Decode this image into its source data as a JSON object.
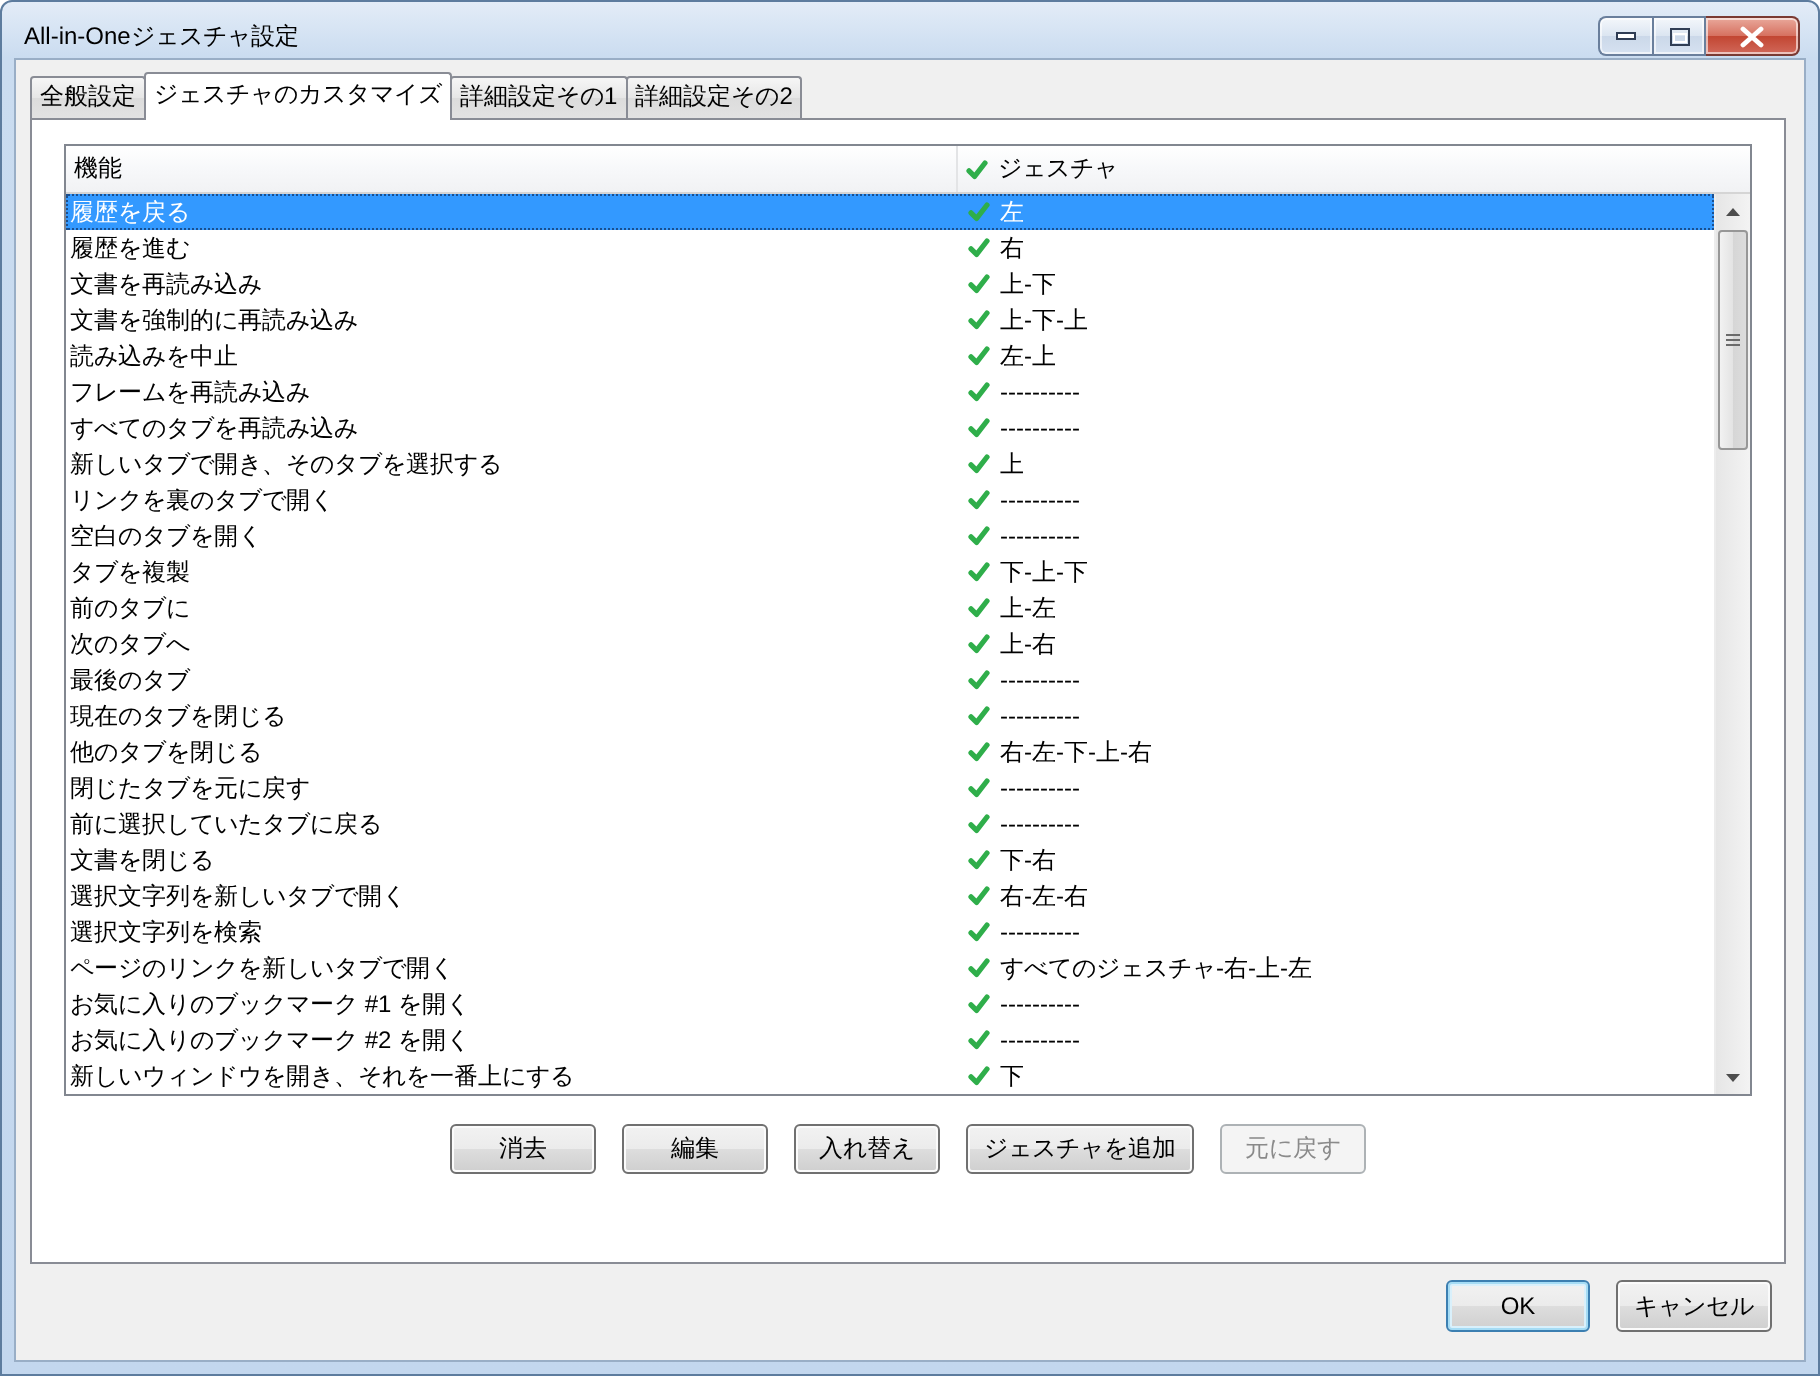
{
  "window": {
    "title": "All-in-Oneジェスチャ設定"
  },
  "tabs": [
    {
      "label": "全般設定",
      "selected": false
    },
    {
      "label": "ジェスチャのカスタマイズ",
      "selected": true
    },
    {
      "label": "詳細設定その1",
      "selected": false
    },
    {
      "label": "詳細設定その2",
      "selected": false
    }
  ],
  "gesture_list": {
    "columns": [
      {
        "label": "機能"
      },
      {
        "label": "ジェスチャ"
      }
    ],
    "rows": [
      {
        "function": "履歴を戻る",
        "enabled": true,
        "gesture": "左",
        "selected": true
      },
      {
        "function": "履歴を進む",
        "enabled": true,
        "gesture": "右",
        "selected": false
      },
      {
        "function": "文書を再読み込み",
        "enabled": true,
        "gesture": "上-下",
        "selected": false
      },
      {
        "function": "文書を強制的に再読み込み",
        "enabled": true,
        "gesture": "上-下-上",
        "selected": false
      },
      {
        "function": "読み込みを中止",
        "enabled": true,
        "gesture": "左-上",
        "selected": false
      },
      {
        "function": "フレームを再読み込み",
        "enabled": true,
        "gesture": "----------",
        "selected": false
      },
      {
        "function": "すべてのタブを再読み込み",
        "enabled": true,
        "gesture": "----------",
        "selected": false
      },
      {
        "function": "新しいタブで開き、そのタブを選択する",
        "enabled": true,
        "gesture": "上",
        "selected": false
      },
      {
        "function": "リンクを裏のタブで開く",
        "enabled": true,
        "gesture": "----------",
        "selected": false
      },
      {
        "function": "空白のタブを開く",
        "enabled": true,
        "gesture": "----------",
        "selected": false
      },
      {
        "function": "タブを複製",
        "enabled": true,
        "gesture": "下-上-下",
        "selected": false
      },
      {
        "function": "前のタブに",
        "enabled": true,
        "gesture": "上-左",
        "selected": false
      },
      {
        "function": "次のタブへ",
        "enabled": true,
        "gesture": "上-右",
        "selected": false
      },
      {
        "function": "最後のタブ",
        "enabled": true,
        "gesture": "----------",
        "selected": false
      },
      {
        "function": "現在のタブを閉じる",
        "enabled": true,
        "gesture": "----------",
        "selected": false
      },
      {
        "function": "他のタブを閉じる",
        "enabled": true,
        "gesture": "右-左-下-上-右",
        "selected": false
      },
      {
        "function": "閉じたタブを元に戻す",
        "enabled": true,
        "gesture": "----------",
        "selected": false
      },
      {
        "function": "前に選択していたタブに戻る",
        "enabled": true,
        "gesture": "----------",
        "selected": false
      },
      {
        "function": "文書を閉じる",
        "enabled": true,
        "gesture": "下-右",
        "selected": false
      },
      {
        "function": "選択文字列を新しいタブで開く",
        "enabled": true,
        "gesture": "右-左-右",
        "selected": false
      },
      {
        "function": "選択文字列を検索",
        "enabled": true,
        "gesture": "----------",
        "selected": false
      },
      {
        "function": "ページのリンクを新しいタブで開く",
        "enabled": true,
        "gesture": "すべてのジェスチャ-右-上-左",
        "selected": false
      },
      {
        "function": "お気に入りのブックマーク #1 を開く",
        "enabled": true,
        "gesture": "----------",
        "selected": false
      },
      {
        "function": "お気に入りのブックマーク #2 を開く",
        "enabled": true,
        "gesture": "----------",
        "selected": false
      },
      {
        "function": "新しいウィンドウを開き、それを一番上にする",
        "enabled": true,
        "gesture": "下",
        "selected": false
      }
    ]
  },
  "actions": [
    {
      "label": "消去",
      "disabled": false
    },
    {
      "label": "編集",
      "disabled": false
    },
    {
      "label": "入れ替え",
      "disabled": false
    },
    {
      "label": "ジェスチャを追加",
      "disabled": false
    },
    {
      "label": "元に戻す",
      "disabled": true
    }
  ],
  "dialog_buttons": [
    {
      "label": "OK",
      "default": true
    },
    {
      "label": "キャンセル",
      "default": false
    }
  ]
}
